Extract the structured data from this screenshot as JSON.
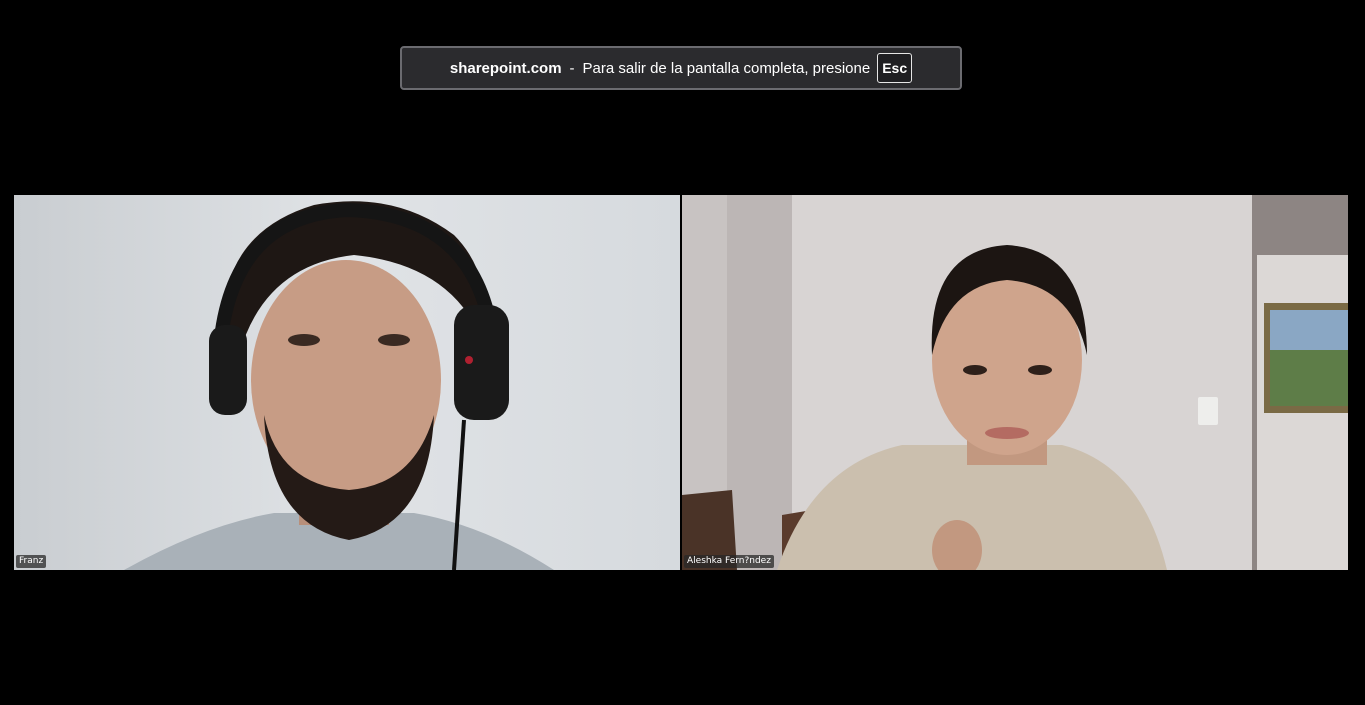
{
  "fullscreen_notice": {
    "host": "sharepoint.com",
    "separator": "-",
    "message": "Para salir de la pantalla completa, presione",
    "key": "Esc"
  },
  "participants": [
    {
      "name": "Franz"
    },
    {
      "name": "Aleshka Fern?ndez"
    }
  ],
  "colors": {
    "background": "#000000",
    "toast_bg": "#2b2b2e",
    "toast_border": "#6b6b70"
  }
}
